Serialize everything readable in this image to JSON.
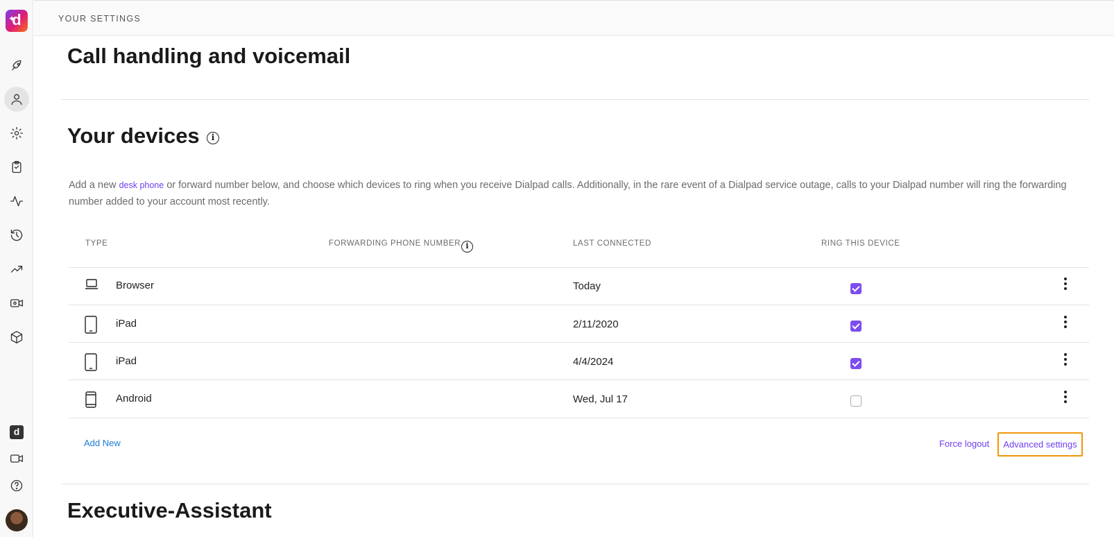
{
  "header": {
    "breadcrumb": "YOUR SETTINGS"
  },
  "sections": {
    "call_handling_title": "Call handling and voicemail",
    "devices_title": "Your devices",
    "executive_title": "Executive-Assistant"
  },
  "devices": {
    "description_before": "Add a new ",
    "description_link": "desk phone",
    "description_after": " or forward number below, and choose which devices to ring when you receive Dialpad calls. Additionally, in the rare event of a Dialpad service outage, calls to your Dialpad number will ring the forwarding number added to your account most recently.",
    "columns": {
      "type": "TYPE",
      "forwarding": "FORWARDING PHONE NUMBER",
      "last_connected": "LAST CONNECTED",
      "ring": "RING THIS DEVICE"
    },
    "rows": [
      {
        "type": "Browser",
        "icon": "laptop-icon",
        "last_connected": "Today",
        "ring": true
      },
      {
        "type": "iPad",
        "icon": "tablet-icon",
        "last_connected": "2/11/2020",
        "ring": true
      },
      {
        "type": "iPad",
        "icon": "tablet-icon",
        "last_connected": "4/4/2024",
        "ring": true
      },
      {
        "type": "Android",
        "icon": "phone-icon",
        "last_connected": "Wed, Jul 17",
        "ring": false
      }
    ],
    "add_new_label": "Add New",
    "force_logout_label": "Force logout",
    "advanced_settings_label": "Advanced settings"
  },
  "colors": {
    "accent": "#7c4df0",
    "link_blue": "#1b7ad8",
    "highlight": "#f0960c"
  },
  "rail_icons": [
    "rocket-icon",
    "user-icon",
    "gear-icon",
    "clipboard-icon",
    "activity-icon",
    "history-icon",
    "trending-icon",
    "video-settings-icon",
    "box-icon",
    "dialpad-app-icon",
    "video-icon",
    "help-icon"
  ]
}
